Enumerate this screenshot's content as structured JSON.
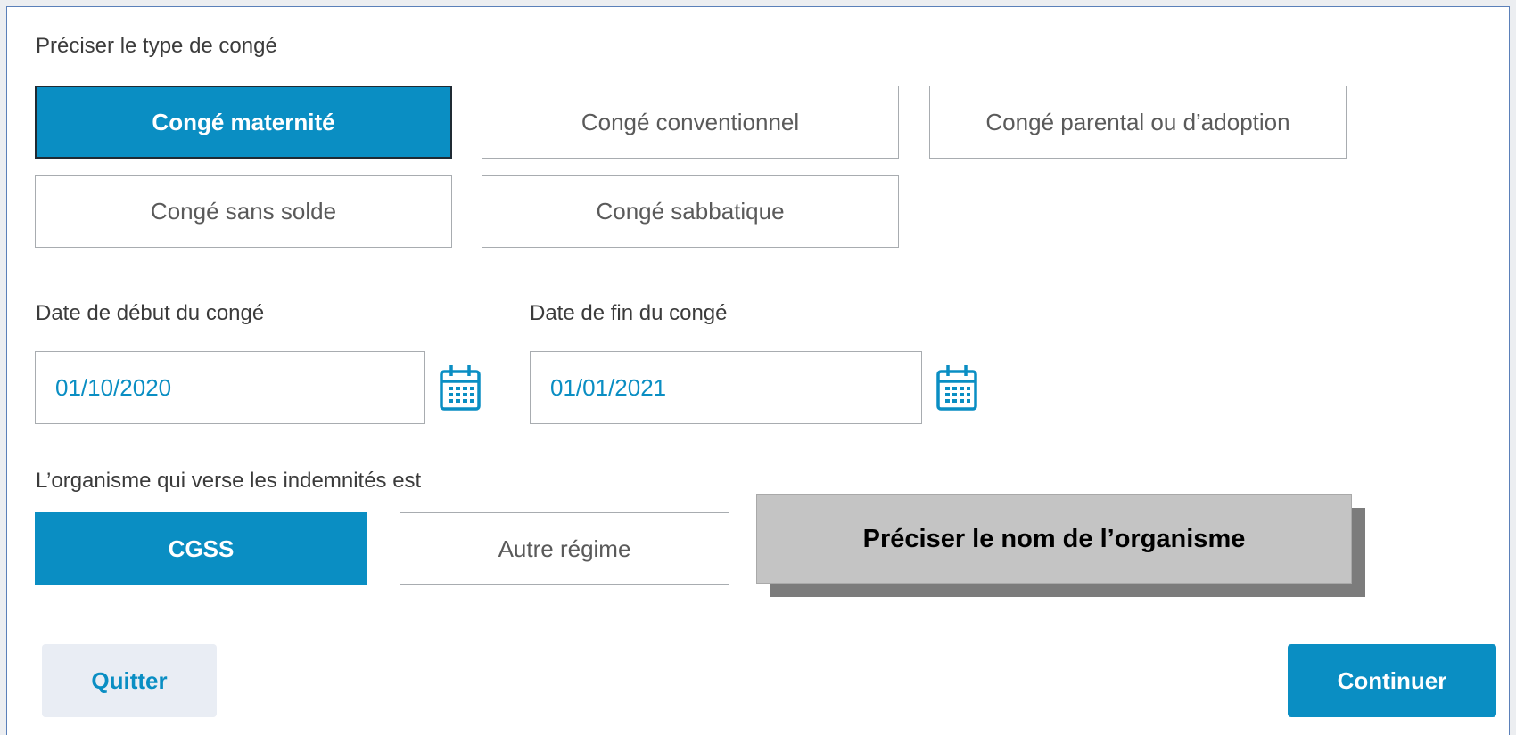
{
  "leave_type": {
    "label": "Préciser le type de congé",
    "options": [
      {
        "label": "Congé maternité",
        "selected": true
      },
      {
        "label": "Congé conventionnel",
        "selected": false
      },
      {
        "label": "Congé parental ou d’adoption",
        "selected": false
      },
      {
        "label": "Congé sans solde",
        "selected": false
      },
      {
        "label": "Congé sabbatique",
        "selected": false
      }
    ]
  },
  "dates": {
    "start_label": "Date de début du congé",
    "start_value": "01/10/2020",
    "end_label": "Date de fin du congé",
    "end_value": "01/01/2021",
    "icon": "calendar-icon"
  },
  "organism": {
    "label": "L’organisme qui verse les indemnités est",
    "options": [
      {
        "label": "CGSS",
        "selected": true
      },
      {
        "label": "Autre régime",
        "selected": false
      }
    ],
    "tooltip": "Préciser le nom de l’organisme"
  },
  "actions": {
    "quit_label": "Quitter",
    "continue_label": "Continuer"
  },
  "colors": {
    "accent": "#0a8ec3",
    "panel_border": "#5b80b9",
    "tooltip_bg": "#c4c4c4"
  }
}
